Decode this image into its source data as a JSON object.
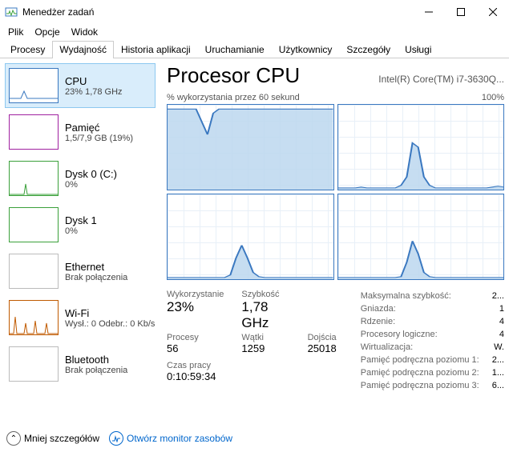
{
  "window": {
    "title": "Menedżer zadań"
  },
  "menu": {
    "file": "Plik",
    "options": "Opcje",
    "view": "Widok"
  },
  "tabs": {
    "processes": "Procesy",
    "performance": "Wydajność",
    "apphistory": "Historia aplikacji",
    "startup": "Uruchamianie",
    "users": "Użytkownicy",
    "details": "Szczegóły",
    "services": "Usługi"
  },
  "sidebar": {
    "cpu": {
      "name": "CPU",
      "sub": "23%  1,78 GHz",
      "color": "#3a78c0"
    },
    "memory": {
      "name": "Pamięć",
      "sub": "1,5/7,9 GB (19%)",
      "color": "#a020a0"
    },
    "disk0": {
      "name": "Dysk 0 (C:)",
      "sub": "0%",
      "color": "#3aa03a"
    },
    "disk1": {
      "name": "Dysk 1",
      "sub": "0%",
      "color": "#3aa03a"
    },
    "eth": {
      "name": "Ethernet",
      "sub": "Brak połączenia",
      "color": "#888"
    },
    "wifi": {
      "name": "Wi-Fi",
      "sub": "Wysł.: 0  Odebr.: 0 Kb/s",
      "color": "#c05a00"
    },
    "bt": {
      "name": "Bluetooth",
      "sub": "Brak połączenia",
      "color": "#888"
    }
  },
  "detail": {
    "title": "Procesor CPU",
    "model": "Intel(R) Core(TM) i7-3630Q...",
    "chartcaption": "% wykorzystania przez 60 sekund",
    "chartmax": "100%",
    "labels": {
      "utilization": "Wykorzystanie",
      "speed": "Szybkość",
      "processes": "Procesy",
      "threads": "Wątki",
      "handles": "Dojścia",
      "uptime": "Czas pracy"
    },
    "values": {
      "utilization": "23%",
      "speed": "1,78 GHz",
      "processes": "56",
      "threads": "1259",
      "handles": "25018",
      "uptime": "0:10:59:34"
    },
    "right": {
      "maxspeed_k": "Maksymalna szybkość:",
      "maxspeed_v": "2...",
      "sockets_k": "Gniazda:",
      "sockets_v": "1",
      "cores_k": "Rdzenie:",
      "cores_v": "4",
      "logical_k": "Procesory logiczne:",
      "logical_v": "4",
      "virt_k": "Wirtualizacja:",
      "virt_v": "W.",
      "l1_k": "Pamięć podręczna poziomu 1:",
      "l1_v": "2...",
      "l2_k": "Pamięć podręczna poziomu 2:",
      "l2_v": "1...",
      "l3_k": "Pamięć podręczna poziomu 3:",
      "l3_v": "6..."
    }
  },
  "footer": {
    "fewer": "Mniej szczegółów",
    "resmon": "Otwórz monitor zasobów"
  },
  "chart_data": {
    "type": "line",
    "title": "% wykorzystania przez 60 sekund",
    "ylabel": "%",
    "ylim": [
      0,
      100
    ],
    "xlim_seconds": [
      -60,
      0
    ],
    "series": [
      {
        "name": "Core 0",
        "values": [
          95,
          95,
          95,
          95,
          95,
          95,
          80,
          65,
          90,
          95,
          95,
          95,
          95,
          95,
          95,
          95,
          95,
          95,
          95,
          95,
          95,
          95,
          95,
          95,
          95,
          95,
          95,
          95,
          95,
          95
        ]
      },
      {
        "name": "Core 1",
        "values": [
          2,
          2,
          2,
          2,
          3,
          2,
          2,
          2,
          2,
          2,
          2,
          5,
          15,
          55,
          50,
          15,
          5,
          2,
          2,
          2,
          2,
          2,
          2,
          2,
          2,
          2,
          2,
          3,
          4,
          3
        ]
      },
      {
        "name": "Core 2",
        "values": [
          2,
          2,
          2,
          2,
          2,
          2,
          2,
          2,
          2,
          2,
          2,
          5,
          25,
          40,
          25,
          8,
          3,
          2,
          2,
          2,
          2,
          2,
          2,
          2,
          2,
          2,
          2,
          2,
          2,
          2
        ]
      },
      {
        "name": "Core 3",
        "values": [
          2,
          2,
          2,
          2,
          2,
          2,
          2,
          2,
          2,
          2,
          2,
          3,
          20,
          45,
          30,
          8,
          3,
          2,
          2,
          2,
          2,
          2,
          2,
          2,
          2,
          2,
          2,
          2,
          2,
          2
        ]
      }
    ]
  }
}
